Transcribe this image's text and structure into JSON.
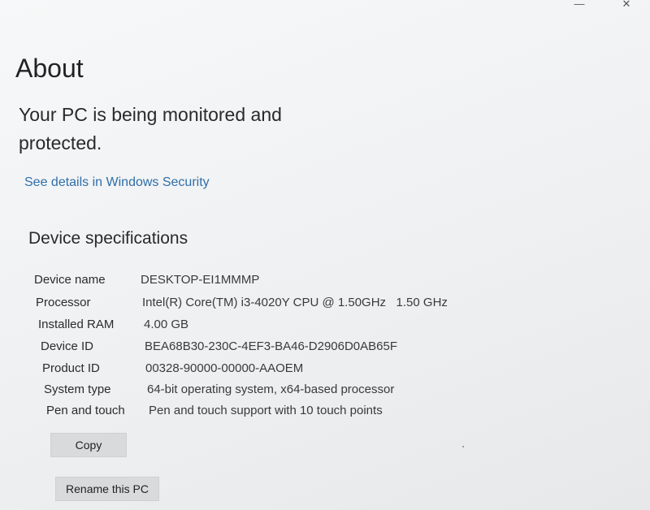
{
  "window": {
    "minimize_glyph": "—",
    "close_glyph": "✕"
  },
  "page": {
    "title": "About",
    "protection_status": "Your PC is being monitored and protected.",
    "security_link": "See details in Windows Security"
  },
  "device_specifications": {
    "heading": "Device specifications",
    "rows": [
      {
        "label": "Device name",
        "value": "DESKTOP-EI1MMMP"
      },
      {
        "label": "Processor",
        "value": "Intel(R) Core(TM) i3-4020Y CPU @ 1.50GHz   1.50 GHz"
      },
      {
        "label": "Installed RAM",
        "value": "4.00 GB"
      },
      {
        "label": "Device ID",
        "value": "BEA68B30-230C-4EF3-BA46-D2906D0AB65F"
      },
      {
        "label": "Product ID",
        "value": "00328-90000-00000-AAOEM"
      },
      {
        "label": "System type",
        "value": "64-bit operating system, x64-based processor"
      },
      {
        "label": "Pen and touch",
        "value": "Pen and touch support with 10 touch points"
      }
    ],
    "copy_button": "Copy"
  },
  "actions": {
    "rename_button": "Rename this PC"
  }
}
